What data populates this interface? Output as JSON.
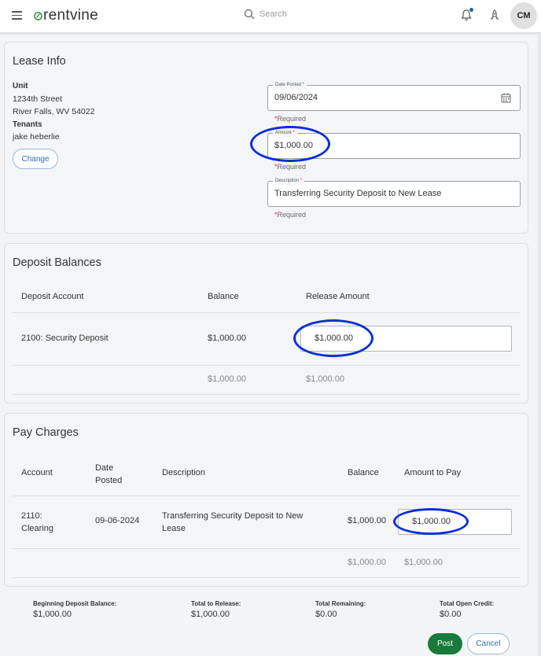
{
  "header": {
    "logo_text": "rentvine",
    "search_placeholder": "Search",
    "avatar_initials": "CM"
  },
  "lease_info": {
    "title": "Lease Info",
    "unit_label": "Unit",
    "unit_line1": "1234th Street",
    "unit_line2": "River Falls, WV 54022",
    "tenants_label": "Tenants",
    "tenant_name": "jake heberlie",
    "change_label": "Change",
    "date_posted": {
      "label": "Date Posted",
      "value": "09/06/2024",
      "required": "Required"
    },
    "amount": {
      "label": "Amount",
      "value": "$1,000.00",
      "required": "Required"
    },
    "description": {
      "label": "Description",
      "value": "Transferring Security Deposit to New Lease",
      "required": "Required"
    }
  },
  "deposit_balances": {
    "title": "Deposit Balances",
    "columns": [
      "Deposit Account",
      "Balance",
      "Release Amount"
    ],
    "row": {
      "account": "2100: Security Deposit",
      "balance": "$1,000.00",
      "release": "$1,000.00"
    },
    "totals": {
      "balance": "$1,000.00",
      "release": "$1,000.00"
    }
  },
  "pay_charges": {
    "title": "Pay Charges",
    "columns": {
      "account": "Account",
      "date_line1": "Date",
      "date_line2": "Posted",
      "description": "Description",
      "balance": "Balance",
      "amount": "Amount to Pay"
    },
    "row": {
      "account_line1": "2110:",
      "account_line2": "Clearing",
      "date": "09-06-2024",
      "desc_line1": "Transferring Security Deposit to New",
      "desc_line2": "Lease",
      "balance": "$1,000.00",
      "amount": "$1,000.00"
    },
    "totals": {
      "balance": "$1,000.00",
      "amount": "$1,000.00"
    }
  },
  "summary": {
    "beginning_label": "Beginning Deposit Balance:",
    "beginning_value": "$1,000.00",
    "release_label": "Total to Release:",
    "release_value": "$1,000.00",
    "remaining_label": "Total Remaining:",
    "remaining_value": "$0.00",
    "credit_label": "Total Open Credit:",
    "credit_value": "$0.00"
  },
  "actions": {
    "post_label": "Post",
    "cancel_label": "Cancel"
  },
  "colors": {
    "brand_green": "#1a7a3c",
    "link_blue": "#2f6db5",
    "annotation_blue": "#0b2fd6",
    "required_red": "#d32f2f"
  },
  "icons": [
    "menu-icon",
    "logo-leaf-icon",
    "search-icon",
    "bell-icon",
    "rocket-icon",
    "calendar-icon"
  ]
}
